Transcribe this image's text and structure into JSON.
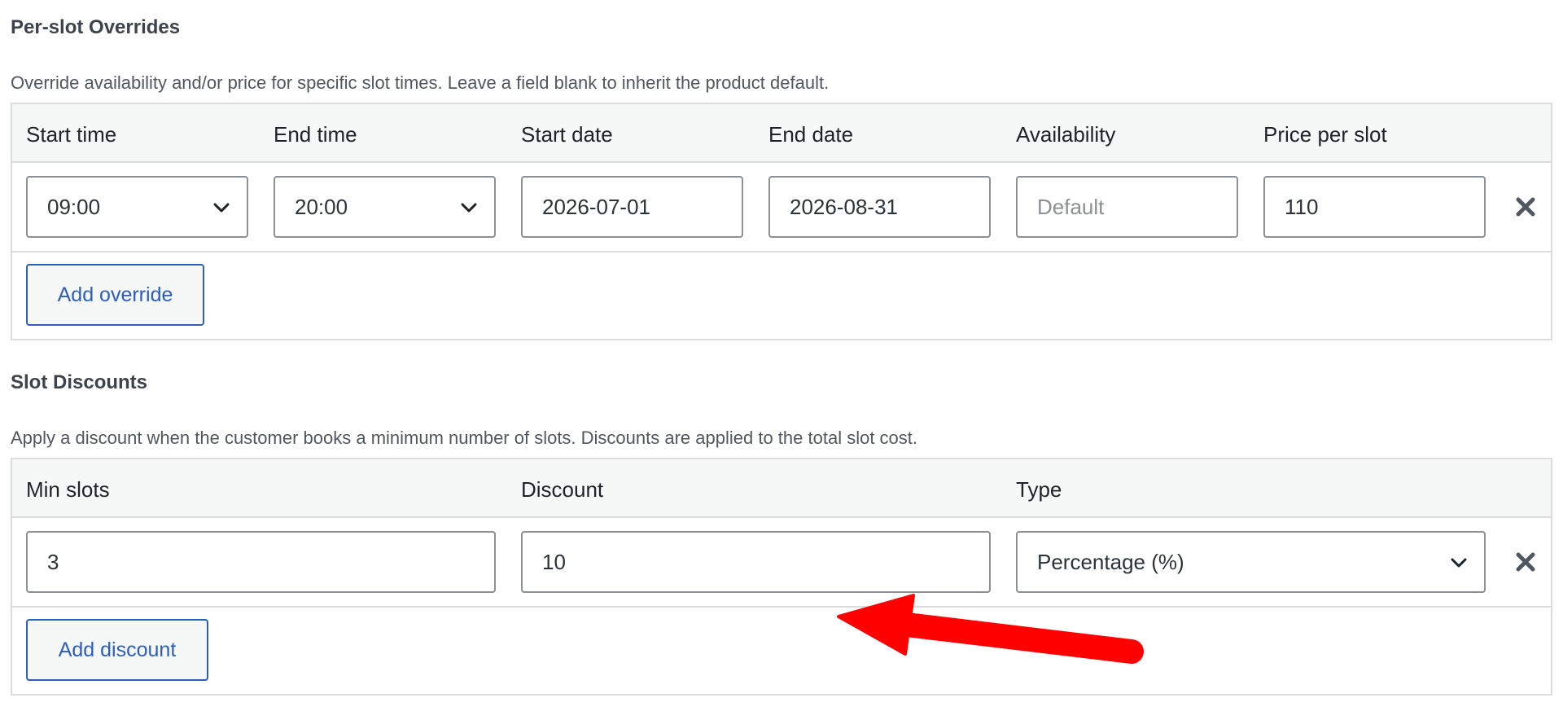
{
  "overrides": {
    "title": "Per-slot Overrides",
    "description": "Override availability and/or price for specific slot times. Leave a field blank to inherit the product default.",
    "columns": [
      "Start time",
      "End time",
      "Start date",
      "End date",
      "Availability",
      "Price per slot"
    ],
    "row": {
      "start_time": "09:00",
      "end_time": "20:00",
      "start_date": "2026-07-01",
      "end_date": "2026-08-31",
      "availability_value": "",
      "availability_placeholder": "Default",
      "price": "110"
    },
    "add_button": "Add override"
  },
  "discounts": {
    "title": "Slot Discounts",
    "description": "Apply a discount when the customer books a minimum number of slots. Discounts are applied to the total slot cost.",
    "columns": [
      "Min slots",
      "Discount",
      "Type"
    ],
    "row": {
      "min_slots": "3",
      "discount": "10",
      "type": "Percentage (%)"
    },
    "add_button": "Add discount"
  },
  "colors": {
    "accent": "#2c5ebd",
    "border": "#dcdcde",
    "header_bg": "#f6f7f7",
    "annotation_arrow": "#ff0000"
  },
  "icons": {
    "dropdown": "chevron-down-icon",
    "remove": "close-icon",
    "annotation": "red-arrow-icon"
  }
}
